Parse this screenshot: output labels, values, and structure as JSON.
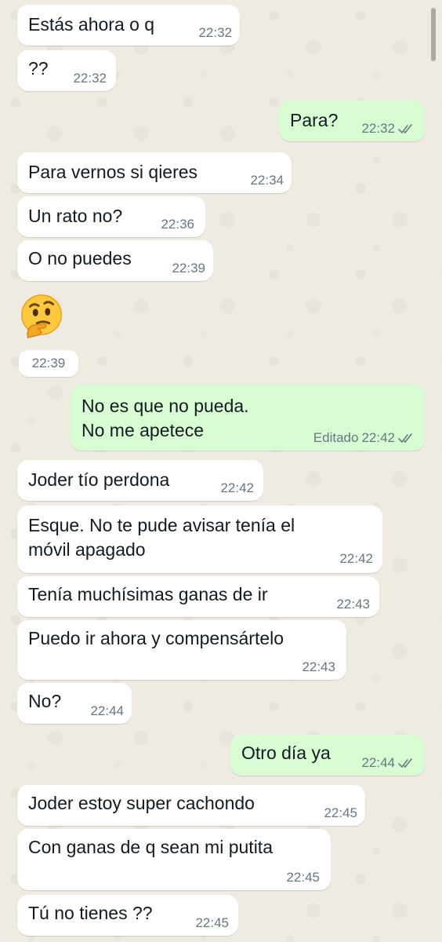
{
  "messages": [
    {
      "dir": "in",
      "text": "Estás ahora o q",
      "time": "22:32"
    },
    {
      "dir": "in",
      "text": "??",
      "time": "22:32"
    },
    {
      "dir": "out",
      "text": "Para?",
      "time": "22:32",
      "read": true
    },
    {
      "dir": "in",
      "text": "Para vernos si qieres",
      "time": "22:34"
    },
    {
      "dir": "in",
      "text": "Un rato no?",
      "time": "22:36"
    },
    {
      "dir": "in",
      "text": "O no puedes",
      "time": "22:39"
    },
    {
      "dir": "in",
      "type": "emoji",
      "emoji_name": "thinking-face-emoji",
      "time": "22:39"
    },
    {
      "dir": "out",
      "text": "No es que no pueda.\nNo me apetece",
      "edited_label": "Editado",
      "time": "22:42",
      "read": true
    },
    {
      "dir": "in",
      "text": "Joder tío perdona",
      "time": "22:42"
    },
    {
      "dir": "in",
      "text": "Esque. No te pude avisar tenía el\nmóvil apagado",
      "time": "22:42"
    },
    {
      "dir": "in",
      "text": "Tenía muchísimas ganas de ir",
      "time": "22:43"
    },
    {
      "dir": "in",
      "text": "Puedo ir ahora y compensártelo",
      "time": "22:43"
    },
    {
      "dir": "in",
      "text": "No?",
      "time": "22:44"
    },
    {
      "dir": "out",
      "text": "Otro día ya",
      "time": "22:44",
      "read": true
    },
    {
      "dir": "in",
      "text": "Joder estoy super cachondo",
      "time": "22:45"
    },
    {
      "dir": "in",
      "text": "Con ganas de q sean mi putita",
      "time": "22:45"
    },
    {
      "dir": "in",
      "text": "Tú no tienes ??",
      "time": "22:45"
    }
  ],
  "colors": {
    "wallpaper": "#efeae2",
    "incoming_bubble": "#ffffff",
    "outgoing_bubble": "#d9fdd3",
    "text": "#111b21",
    "meta": "#667781",
    "read_ticks": "#667781"
  }
}
